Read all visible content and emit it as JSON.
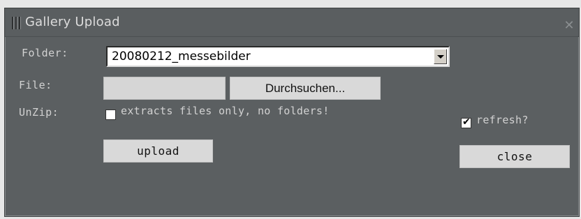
{
  "window": {
    "title": "Gallery Upload"
  },
  "form": {
    "folder_label": "Folder:",
    "folder_value": "20080212_messebilder",
    "file_label": "File:",
    "browse_label": "Durchsuchen...",
    "unzip_label": "UnZip:",
    "unzip_option_label": "extracts files only, no folders!",
    "unzip_checked": false,
    "refresh_label": "refresh?",
    "refresh_checked": true,
    "upload_label": "upload",
    "close_label": "close"
  },
  "icons": {
    "grip": "drag-grip-icon",
    "close": "close-x-icon",
    "dropdown": "chevron-down-icon"
  },
  "colors": {
    "window_bg": "#5b5f61",
    "text": "#d2d2d2",
    "button_bg": "#d9d9d9"
  }
}
